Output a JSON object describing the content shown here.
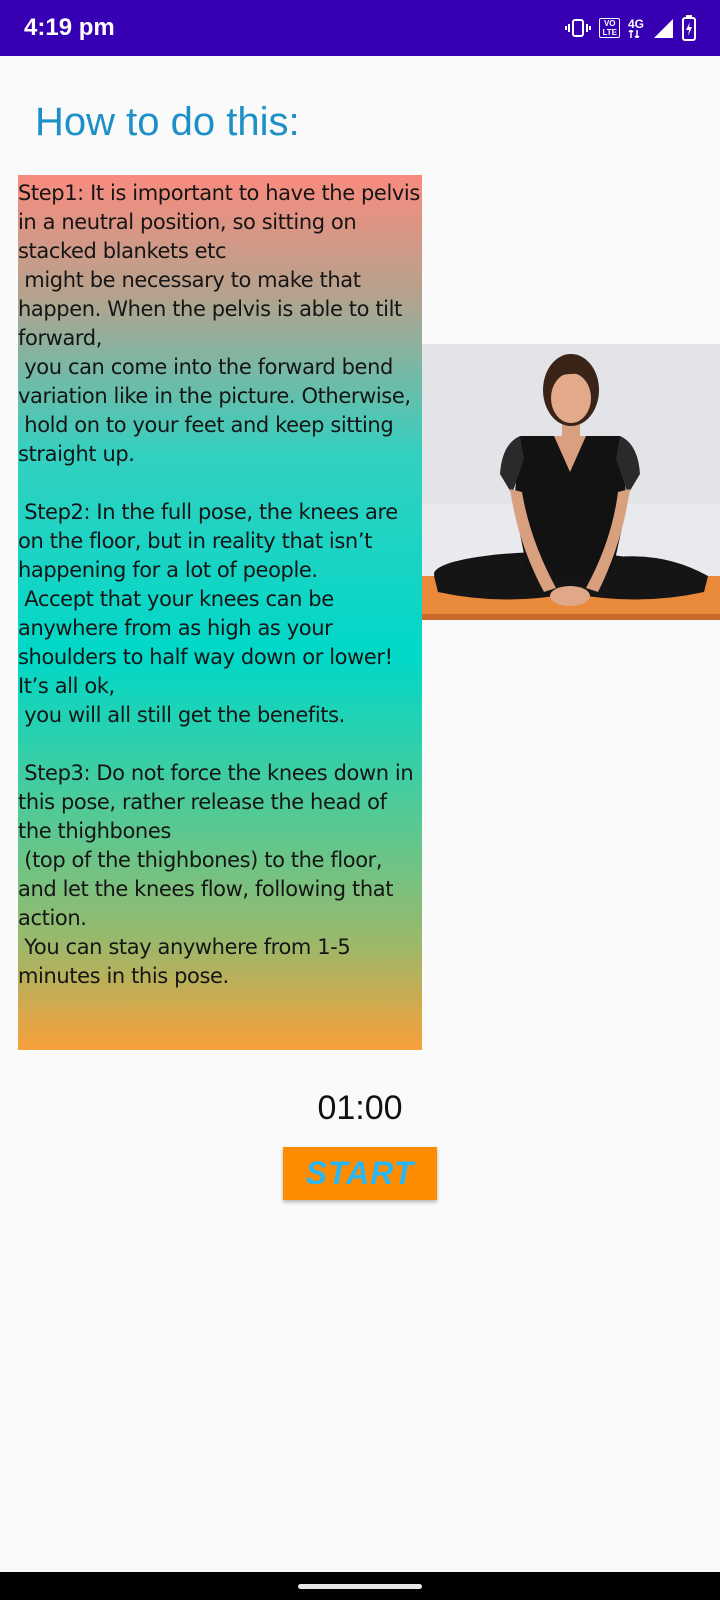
{
  "status_bar": {
    "time": "4:19 pm",
    "volte_top": "VO",
    "volte_bottom": "LTE",
    "network": "4G",
    "icons": [
      "vibrate-icon",
      "volte-icon",
      "network-4g-icon",
      "signal-icon",
      "battery-charging-icon"
    ],
    "background": "#3700b3"
  },
  "page": {
    "title": "How to do this:",
    "title_color": "#1e90c8"
  },
  "steps": {
    "text": "Step1: It is important to have the pelvis in a neutral position, so sitting on stacked blankets etc\n might be necessary to make that happen. When the pelvis is able to tilt forward,\n you can come into the forward bend variation like in the picture. Otherwise,\n hold on to your feet and keep sitting straight up.\n\n Step2: In the full pose, the knees are on the floor, but in reality that isn’t happening for a lot of people.\n Accept that your knees can be anywhere from as high as your shoulders to half way down or lower! It’s all ok,\n you will all still get the benefits.\n\n Step3: Do not force the knees down in this pose, rather release the head of the thighbones\n (top of the thighbones) to the floor, and let the knees flow, following that action.\n You can stay anywhere from 1-5 minutes in this pose."
  },
  "image": {
    "subject": "woman seated in bound angle pose"
  },
  "timer": {
    "value": "01:00"
  },
  "controls": {
    "start_label": "START",
    "start_bg": "#ff8c00",
    "start_fg": "#29b6f6"
  }
}
